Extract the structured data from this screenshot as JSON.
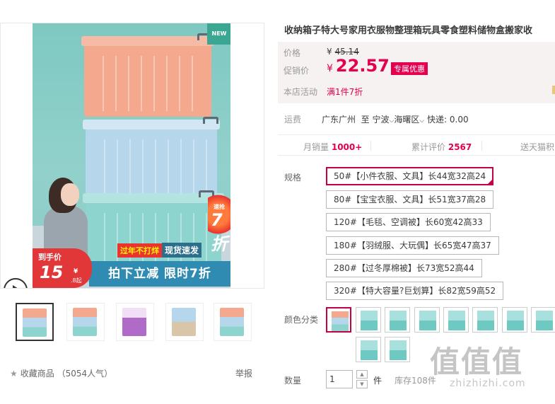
{
  "gallery": {
    "new_tag": "NEW",
    "promo_flame": {
      "top": "速抢",
      "main": "7折"
    },
    "banner_top": {
      "left": "过年不打烊",
      "right": "现货速发"
    },
    "banner_bottom": "拍下立减 限时7折",
    "price_badge": {
      "label": "到手价",
      "amount": "15",
      "decimal": ".8",
      "yen": "¥",
      "suffix": "起"
    },
    "thumbnails": 5
  },
  "footer": {
    "favorite_label": "收藏商品",
    "favorite_count": "（5054人气）",
    "report_label": "举报"
  },
  "product": {
    "title": "收纳箱子特大号家用衣服物整理箱玩具零食塑料储物盒搬家收"
  },
  "price_panel": {
    "price_label": "价格",
    "original_yen": "¥",
    "original_price": "45.14",
    "promo_label": "促销价",
    "promo_yen": "¥",
    "promo_price": "22.57",
    "promo_tag": "专属优惠",
    "activity_label": "本店活动",
    "activity_text": "满1件7折"
  },
  "shipping": {
    "label": "运费",
    "from": "广东广州",
    "to_word": "至",
    "city": "宁波",
    "district": "海曙区",
    "fee": "快递: 0.00"
  },
  "stats": {
    "monthly_label": "月销量",
    "monthly_value": "1000+",
    "reviews_label": "累计评价",
    "reviews_value": "2567",
    "points_label": "送天猫积"
  },
  "specs": {
    "label": "规格",
    "options": [
      "50#【小件衣服、文具】长44宽32高24",
      "80#【宝宝衣服、文具】长51宽37高28",
      "120#【毛毯、空调被】长60宽42高33",
      "180#【羽绒服、大玩偶】长65宽47高37",
      "280#【过冬厚棉被】长73宽52高44",
      "320#【特大容量?巨划算】长82宽59高52"
    ]
  },
  "colors": {
    "label": "颜色分类",
    "count": 10
  },
  "quantity": {
    "label": "数量",
    "value": "1",
    "unit": "件",
    "stock": "库存108件"
  },
  "watermark": {
    "big": "值值值",
    "small": "zhizhizhi.com"
  },
  "accent_color": "#e5004f"
}
